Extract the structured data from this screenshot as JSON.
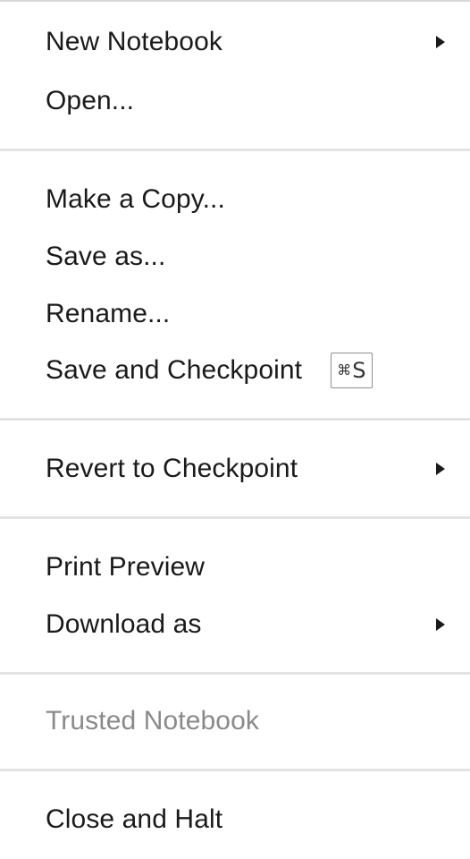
{
  "menu": {
    "items": [
      {
        "label": "New Notebook",
        "submenu": true
      },
      {
        "label": "Open..."
      },
      {
        "label": "Make a Copy..."
      },
      {
        "label": "Save as..."
      },
      {
        "label": "Rename..."
      },
      {
        "label": "Save and Checkpoint",
        "shortcut": {
          "modifier": "⌘",
          "key": "S"
        }
      },
      {
        "label": "Revert to Checkpoint",
        "submenu": true
      },
      {
        "label": "Print Preview"
      },
      {
        "label": "Download as",
        "submenu": true
      },
      {
        "label": "Trusted Notebook",
        "disabled": true
      },
      {
        "label": "Close and Halt"
      }
    ],
    "submenu_icon": "caret-right-icon",
    "colors": {
      "text": "#1a1a1a",
      "disabled_text": "#8a8a8a",
      "divider": "#e3e3e3",
      "background": "#ffffff"
    }
  }
}
